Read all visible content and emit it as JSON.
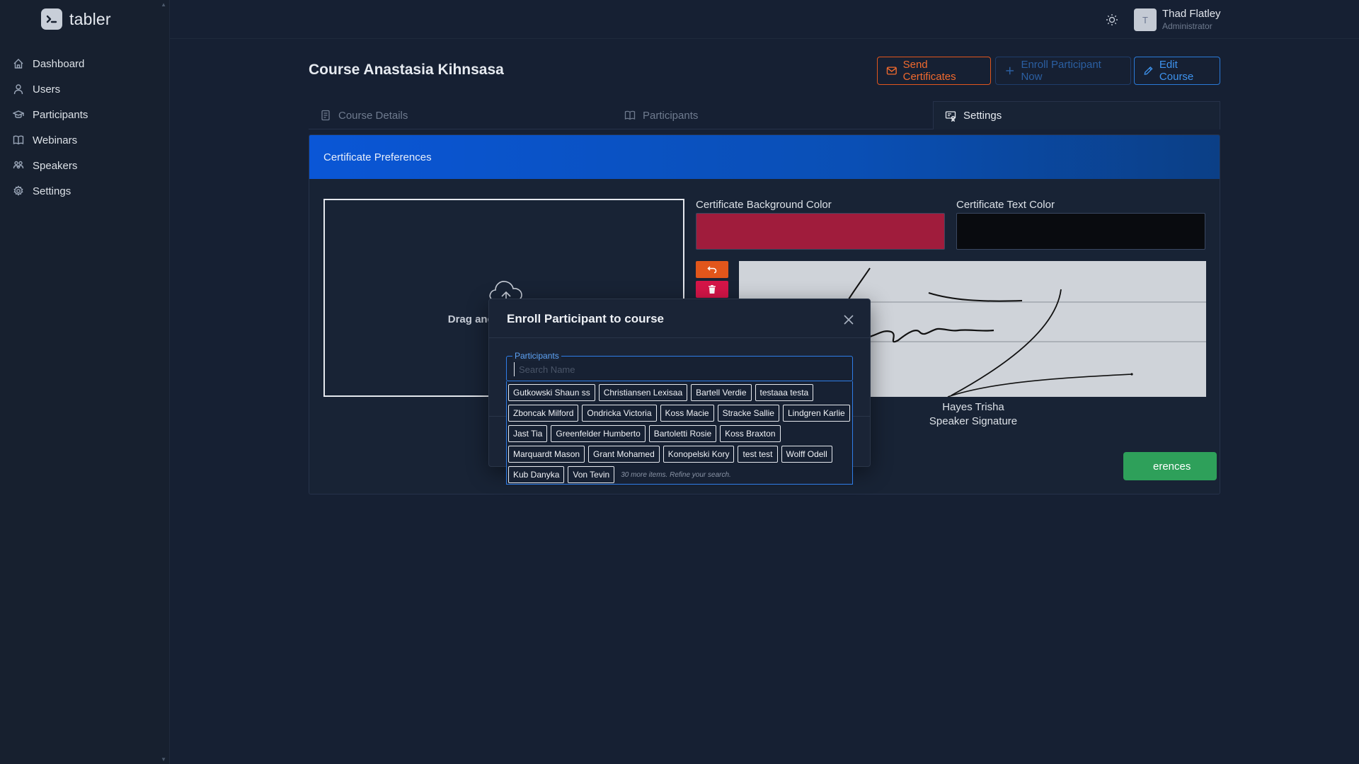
{
  "brand": {
    "name": "tabler"
  },
  "sidebar": {
    "items": [
      {
        "label": "Dashboard",
        "icon": "home-icon"
      },
      {
        "label": "Users",
        "icon": "user-icon"
      },
      {
        "label": "Participants",
        "icon": "school-icon"
      },
      {
        "label": "Webinars",
        "icon": "book-icon"
      },
      {
        "label": "Speakers",
        "icon": "users-group-icon"
      },
      {
        "label": "Settings",
        "icon": "gear-icon"
      }
    ]
  },
  "header": {
    "user": {
      "initial": "T",
      "name": "Thad Flatley",
      "role": "Administrator"
    },
    "theme_icon": "sun-icon"
  },
  "page": {
    "title": "Course Anastasia Kihnsasa",
    "buttons": {
      "send": "Send Certificates",
      "enroll": "Enroll Participant Now",
      "edit": "Edit Course"
    }
  },
  "tabs": [
    {
      "label": "Course Details",
      "active": false
    },
    {
      "label": "Participants",
      "active": false
    },
    {
      "label": "Settings",
      "active": true
    }
  ],
  "card": {
    "title": "Certificate Preferences",
    "dropzone_text": "Drag and drop your Ba",
    "bg_color_label": "Certificate Background Color",
    "bg_color_value": "#a01c3c",
    "text_color_label": "Certificate Text Color",
    "text_color_value": "#090b0f",
    "speaker_name": "Hayes Trisha",
    "speaker_role": "Speaker Signature",
    "save_label": "erences"
  },
  "modal": {
    "title": "Enroll Participant to course",
    "field_legend": "Participants",
    "search_placeholder": "Search Name",
    "options": [
      "Gutkowski Shaun ss",
      "Christiansen Lexisaa",
      "Bartell Verdie",
      "testaaa testa",
      "Zboncak Milford",
      "Ondricka Victoria",
      "Koss Macie",
      "Stracke Sallie",
      "Lindgren Karlie",
      "Jast Tia",
      "Greenfelder Humberto",
      "Bartoletti Rosie",
      "Koss Braxton",
      "Marquardt Mason",
      "Grant Mohamed",
      "Konopelski Kory",
      "test test",
      "Wolff Odell",
      "Kub Danyka",
      "Von Tevin"
    ],
    "more_note": "30 more items. Refine your search."
  },
  "colors": {
    "accent_blue": "#0a56d6",
    "orange": "#e1561b",
    "red": "#d51548",
    "green": "#2ea05a"
  }
}
